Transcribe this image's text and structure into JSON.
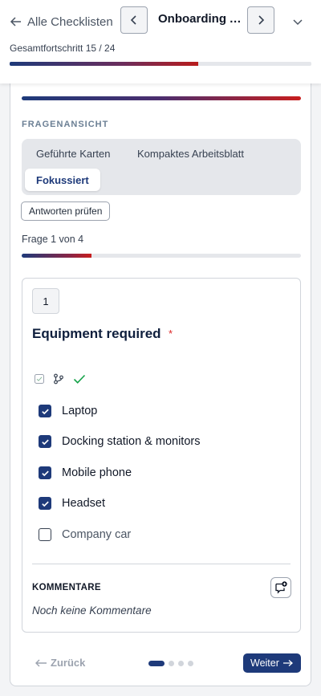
{
  "header": {
    "back_label": "Alle Checklisten",
    "checklist_title": "Onboarding A...",
    "progress_label": "Gesamtfortschritt 15 / 24",
    "progress_fraction": 0.625
  },
  "view": {
    "section_label": "FRAGENANSICHT",
    "tabs": [
      {
        "label": "Geführte Karten",
        "selected": false
      },
      {
        "label": "Kompaktes Arbeitsblatt",
        "selected": false
      },
      {
        "label": "Fokussiert",
        "selected": true
      }
    ],
    "review_button": "Antworten prüfen",
    "question_counter": "Frage 1 von 4",
    "question_progress_fraction": 0.25
  },
  "question": {
    "number": "1",
    "title": "Equipment required",
    "required_marker": "*",
    "options": [
      {
        "label": "Laptop",
        "checked": true
      },
      {
        "label": "Docking station & monitors",
        "checked": true
      },
      {
        "label": "Mobile phone",
        "checked": true
      },
      {
        "label": "Headset",
        "checked": true
      },
      {
        "label": "Company car",
        "checked": false
      }
    ]
  },
  "comments": {
    "heading": "KOMMENTARE",
    "empty_text": "Noch keine Kommentare"
  },
  "footer": {
    "back_label": "Zurück",
    "next_label": "Weiter",
    "total_steps": 4,
    "active_step": 1
  },
  "colors": {
    "primary": "#1e3a7a",
    "accent_red": "#c81e1e",
    "required": "#dc2626"
  }
}
